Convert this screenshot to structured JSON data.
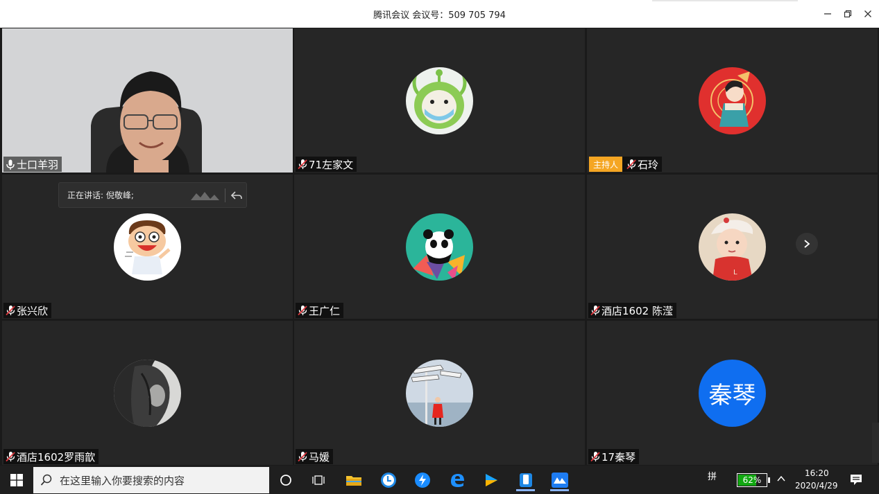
{
  "window": {
    "title": "腾讯会议 会议号：509 705 794"
  },
  "speaking": {
    "text": "正在讲话: 倪敬峰;"
  },
  "participants": [
    {
      "name": "士口羊羽",
      "avatar": "webcam-video",
      "muted": false
    },
    {
      "name": "71左家文",
      "avatar": "green-alien-avatar",
      "muted": true
    },
    {
      "name": "石玲",
      "avatar": "red-fan-girl-avatar",
      "muted": true,
      "badge": "主持人"
    },
    {
      "name": "张兴欣",
      "avatar": "cartoon-boy-avatar",
      "muted": true
    },
    {
      "name": "王广仁",
      "avatar": "panda-avatar",
      "muted": true
    },
    {
      "name": "酒店1602 陈滢",
      "avatar": "baby-photo-avatar",
      "muted": true
    },
    {
      "name": "酒店1602罗雨歆",
      "avatar": "bw-portrait-avatar",
      "muted": true
    },
    {
      "name": "马媛",
      "avatar": "signpost-photo-avatar",
      "muted": true
    },
    {
      "name": "17秦琴",
      "avatar": "text-avatar",
      "avatar_text": "秦琴",
      "muted": true
    }
  ],
  "taskbar": {
    "search_placeholder": "在这里输入你要搜索的内容",
    "ime": "拼",
    "battery": "62%",
    "battery_level": 0.62,
    "time": "16:20",
    "date": "2020/4/29"
  },
  "colors": {
    "tile_bg": "#262626",
    "host_badge": "#f5a623",
    "text_avatar": "#0f6ef0"
  }
}
